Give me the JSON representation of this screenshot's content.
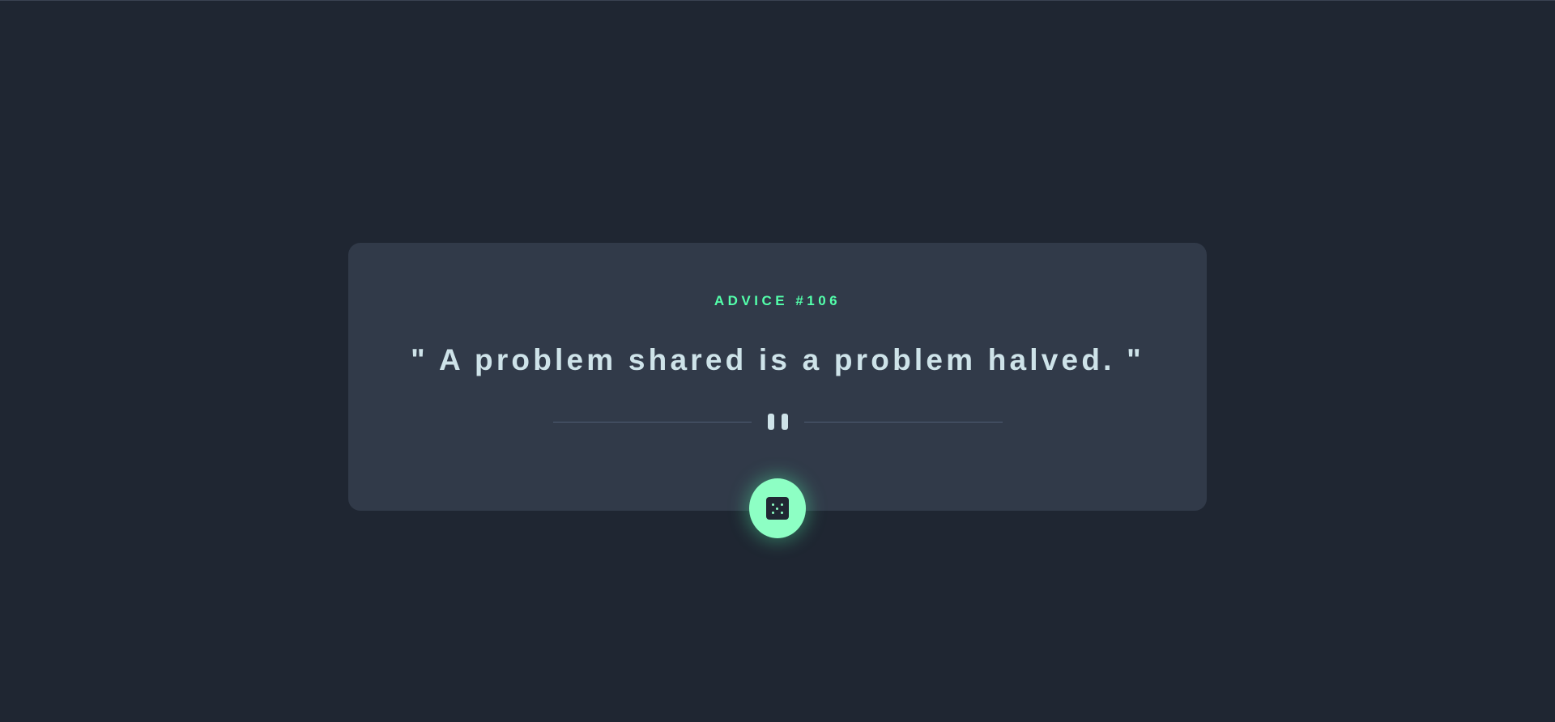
{
  "card": {
    "advice_label": "ADVICE #106",
    "advice_text": "\" A problem shared is a problem halved. \""
  },
  "icons": {
    "divider": "pause-icon",
    "button": "dice-icon"
  },
  "colors": {
    "background": "#1f2632",
    "card": "#313a49",
    "accent": "#53ffab",
    "text": "#cee3e9",
    "button": "#8dffc4"
  }
}
